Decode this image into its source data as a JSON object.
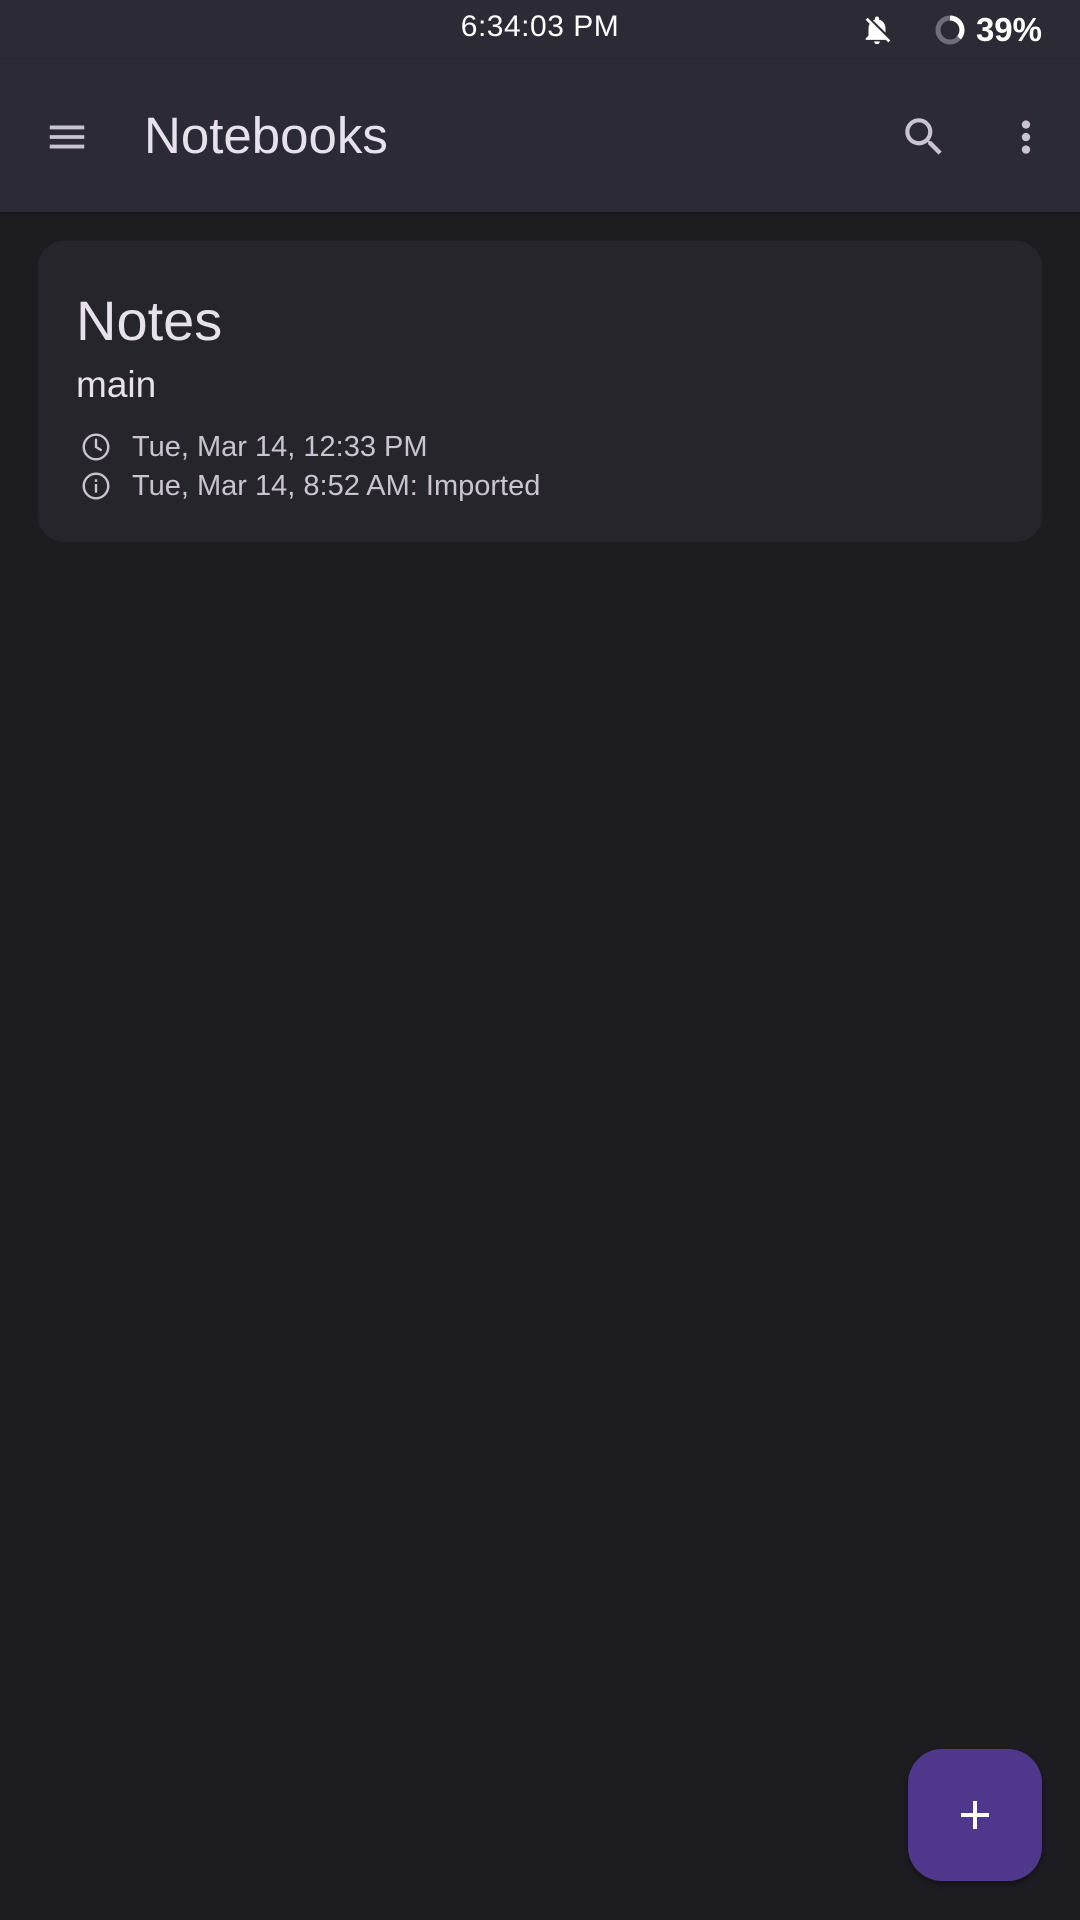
{
  "status_bar": {
    "time": "6:34:03 PM",
    "battery_percent": "39%",
    "icons": [
      "bell-off-icon",
      "battery-ring-icon"
    ]
  },
  "app_bar": {
    "title": "Notebooks",
    "icons": [
      "menu-icon",
      "search-icon",
      "more-vert-icon"
    ]
  },
  "notebooks": [
    {
      "title": "Notes",
      "subtitle": "main",
      "modified": "Tue, Mar 14, 12:33 PM",
      "info": "Tue, Mar 14, 8:52 AM: Imported",
      "icons": [
        "clock-icon",
        "info-icon"
      ]
    }
  ],
  "fab": {
    "icon": "plus-icon"
  },
  "colors": {
    "background": "#1d1c21",
    "app_bar": "#2b2a35",
    "card": "#26252c",
    "fab": "#4f378b",
    "text_primary": "#e6e1ea",
    "text_secondary": "#c9c4cf"
  }
}
